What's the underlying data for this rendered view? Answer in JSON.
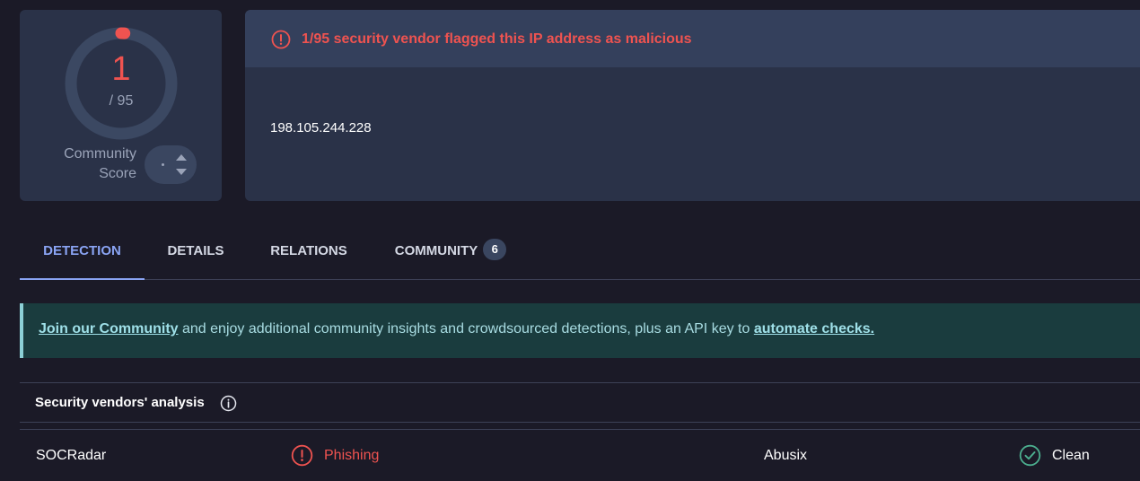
{
  "score": {
    "detections": "1",
    "total": "/ 95",
    "detection_fraction": 0.0105,
    "community_label": "Community Score",
    "community_label_line1": "Community",
    "community_label_line2": "Score"
  },
  "alert": {
    "text": "1/95 security vendor flagged this IP address as malicious",
    "icon": "exclamation-circle-icon",
    "color": "#ef5350"
  },
  "ip": "198.105.244.228",
  "tabs": [
    {
      "label": "DETECTION",
      "active": true
    },
    {
      "label": "DETAILS",
      "active": false
    },
    {
      "label": "RELATIONS",
      "active": false
    },
    {
      "label": "COMMUNITY",
      "active": false,
      "badge": "6"
    }
  ],
  "banner": {
    "link1": "Join our Community",
    "middle": " and enjoy additional community insights and crowdsourced detections, plus an API key to ",
    "link2": "automate checks."
  },
  "vendors_section": {
    "title": "Security vendors' analysis",
    "icon": "info-circle-icon"
  },
  "vendor_rows": [
    {
      "left": {
        "vendor": "SOCRadar",
        "result": "Phishing",
        "icon": "exclamation-circle-icon",
        "color": "#ef5350"
      },
      "right": {
        "vendor": "Abusix",
        "result": "Clean",
        "icon": "check-circle-icon",
        "color": "#4caf8f"
      }
    }
  ],
  "colors": {
    "accent": "#8aa4f4",
    "malicious": "#ef5350",
    "clean": "#4caf8f",
    "banner_bg": "#1a3c3e"
  }
}
